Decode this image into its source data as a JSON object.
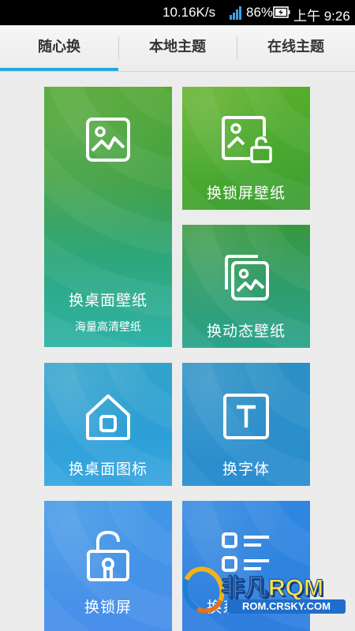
{
  "status_bar": {
    "network_speed": "10.16K/s",
    "battery_percent": "86%",
    "time": "上午 9:26"
  },
  "tabs": [
    {
      "label": "随心换",
      "active": true
    },
    {
      "label": "本地主题",
      "active": false
    },
    {
      "label": "在线主题",
      "active": false
    }
  ],
  "tiles": {
    "desktop_wallpaper": {
      "label": "换桌面壁纸",
      "sub": "海量高清壁纸",
      "icon": "image-icon"
    },
    "lock_wallpaper": {
      "label": "换锁屏壁纸",
      "icon": "image-lock-icon"
    },
    "live_wallpaper": {
      "label": "换动态壁纸",
      "icon": "image-stack-icon"
    },
    "desktop_icons": {
      "label": "换桌面图标",
      "icon": "home-icon"
    },
    "font": {
      "label": "换字体",
      "icon": "text-icon"
    },
    "lock_screen": {
      "label": "换锁屏",
      "icon": "unlock-icon"
    },
    "system_plugins": {
      "label": "换系统插件",
      "icon": "list-icon"
    }
  },
  "watermark": {
    "brand": "RQM",
    "brand_cn": "非凡",
    "url": "ROM.CRSKY.COM"
  }
}
